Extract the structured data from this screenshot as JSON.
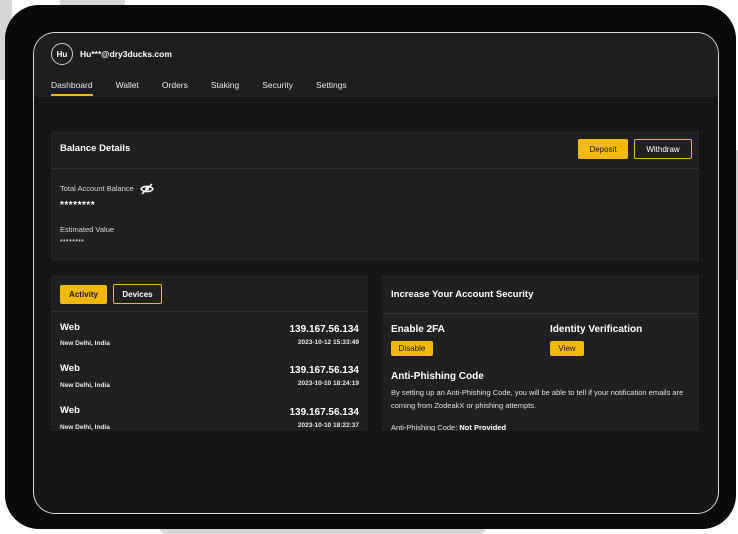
{
  "user": {
    "initials": "Hu",
    "email": "Hu***@dry3ducks.com"
  },
  "nav": {
    "items": [
      {
        "label": "Dashboard",
        "active": true
      },
      {
        "label": "Wallet",
        "active": false
      },
      {
        "label": "Orders",
        "active": false
      },
      {
        "label": "Staking",
        "active": false
      },
      {
        "label": "Security",
        "active": false
      },
      {
        "label": "Settings",
        "active": false
      }
    ]
  },
  "balance": {
    "title": "Balance Details",
    "deposit_label": "Deposit",
    "withdraw_label": "Withdraw",
    "total_label": "Total Account Balance",
    "total_value": "********",
    "estimated_label": "Estimated Value",
    "estimated_value": "********"
  },
  "activity": {
    "tab_activity": "Activity",
    "tab_devices": "Devices",
    "rows": [
      {
        "device": "Web",
        "location": "New Delhi, India",
        "ip": "139.167.56.134",
        "time": "2023-10-12 15:33:49"
      },
      {
        "device": "Web",
        "location": "New Delhi, India",
        "ip": "139.167.56.134",
        "time": "2023-10-10 18:24:19"
      },
      {
        "device": "Web",
        "location": "New Delhi, India",
        "ip": "139.167.56.134",
        "time": "2023-10-10 18:22:37"
      }
    ]
  },
  "security": {
    "title": "Increase Your Account Security",
    "twofa_title": "Enable 2FA",
    "twofa_button": "Disable",
    "identity_title": "Identity Verification",
    "identity_button": "View",
    "antiphishing_title": "Anti-Phishing Code",
    "antiphishing_text": "By setting up an Anti-Phishing Code, you will be able to tell if your notification emails are coming from ZodeakX or phishing attempts.",
    "antiphishing_status_label": "Anti-Phishing Code:",
    "antiphishing_status_value": "Not Provided"
  },
  "colors": {
    "accent": "#f0b90b",
    "background": "#161616",
    "card": "#202020"
  },
  "icons": {
    "hidden_eye": "eye-off-icon"
  }
}
